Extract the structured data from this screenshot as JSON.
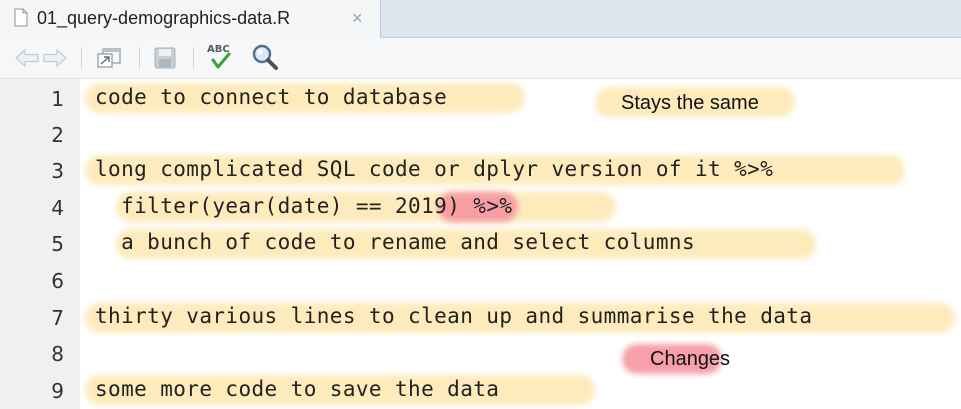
{
  "tab": {
    "title": "01_query-demographics-data.R",
    "close_glyph": "×",
    "icon": "file-icon"
  },
  "toolbar": {
    "items": [
      "back-icon",
      "forward-icon",
      "show-in-window-icon",
      "save-icon",
      "spellcheck-icon",
      "search-icon"
    ],
    "spellcheck_label": "ABC"
  },
  "colors": {
    "highlight_yellow": "#fde8b0",
    "highlight_red": "#f696a0",
    "gutter_bg": "#f0f0f0",
    "tabbar_bg": "#dde5ee"
  },
  "editor": {
    "lines": [
      {
        "num": "1",
        "text": "code to connect to database"
      },
      {
        "num": "2",
        "text": ""
      },
      {
        "num": "3",
        "text": "long complicated SQL code or dplyr version of it %>%"
      },
      {
        "num": "4",
        "text_pre": "  filter(year(date) == ",
        "text_num": "2019",
        "text_post": ") %>%"
      },
      {
        "num": "5",
        "text": "  a bunch of code to rename and select columns"
      },
      {
        "num": "6",
        "text": ""
      },
      {
        "num": "7",
        "text": "thirty various lines to clean up and summarise the data"
      },
      {
        "num": "8",
        "text": ""
      },
      {
        "num": "9",
        "text": "some more code to save the data"
      }
    ]
  },
  "annotations": {
    "same": "Stays the same",
    "changes": "Changes"
  }
}
